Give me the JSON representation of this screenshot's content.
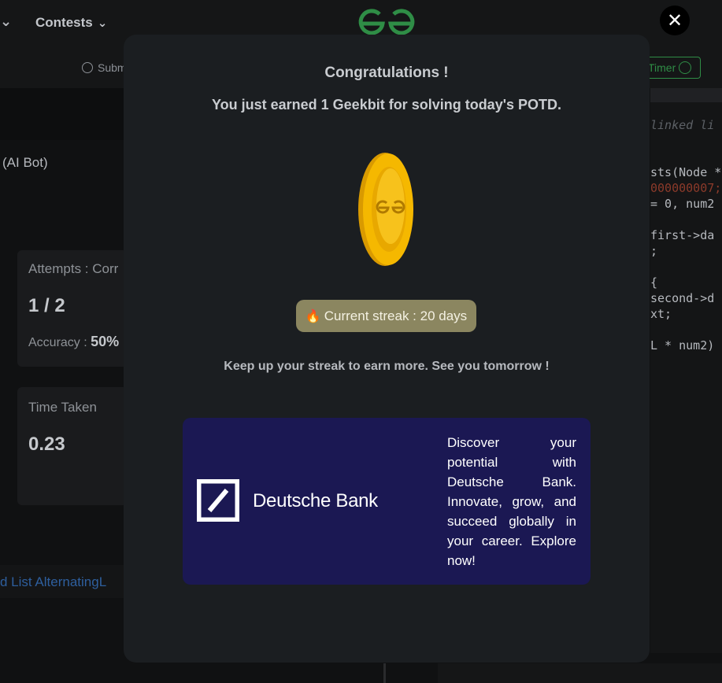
{
  "topbar": {
    "contests_label": "Contests",
    "chevron_glyph": "❯"
  },
  "close_button": {
    "glyph": "✕"
  },
  "submission_bar": {
    "submissions_label": "Subm",
    "timer_label": "Timer"
  },
  "left_panel": {
    "ai_bot_label": "(AI Bot)",
    "attempts_label": "Attempts : Corr",
    "attempts_value": "1 / 2",
    "accuracy_label": "Accuracy : ",
    "accuracy_value": "50%",
    "time_label": "Time Taken",
    "time_value": "0.23",
    "bottom_link": "d List AlternatingL"
  },
  "editor": {
    "lines": [
      {
        "text": " linked li",
        "kind": "comment"
      },
      {
        "text": "sts(Node *",
        "kind": "code"
      },
      {
        "text": "000000007;",
        "kind": "num"
      },
      {
        "text": "= 0, num2",
        "kind": "code"
      },
      {
        "text": " first->da",
        "kind": "code"
      },
      {
        "text": ";",
        "kind": "code"
      },
      {
        "text": "{",
        "kind": "code"
      },
      {
        "text": " second->d",
        "kind": "code"
      },
      {
        "text": "xt;",
        "kind": "code"
      },
      {
        "text": "L * num2)",
        "kind": "code"
      }
    ]
  },
  "modal": {
    "title": "Congratulations !",
    "earned_text": "You just earned 1 Geekbit for solving today's POTD.",
    "streak_text": "Current streak : 20 days",
    "keep_up_text": "Keep up your streak to earn more. See you tomorrow !",
    "ad": {
      "brand_name": "Deutsche Bank",
      "text": "Discover your potential with Deutsche Bank. Innovate, grow, and succeed globally in your career. Explore now!"
    }
  },
  "icons": {
    "logo": "gfg-logo-icon",
    "coin": "geekbit-coin-icon",
    "fire": "fire-icon",
    "close": "close-icon",
    "clock": "clock-icon",
    "play": "play-circle-icon",
    "brand": "deutsche-bank-logo-icon"
  },
  "colors": {
    "brand_green": "#2f8d46",
    "modal_bg": "#1b1e21",
    "streak_bg": "#8b8660",
    "ad_bg": "#1b1853",
    "coin_gold": "#f5b800"
  }
}
